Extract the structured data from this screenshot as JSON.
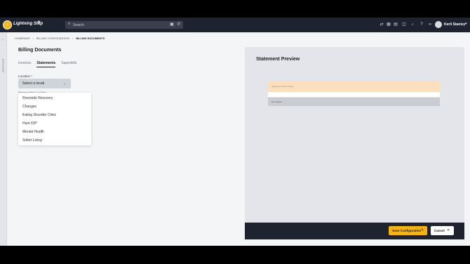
{
  "app": {
    "brand": "Lightning Step"
  },
  "search": {
    "placeholder": "Search"
  },
  "user": {
    "name": "Kerli Stanley"
  },
  "sidebar": {
    "collapsed_label": "Dashboard"
  },
  "breadcrumb": [
    "HOMEPAGE",
    "BILLING CONFIGURATION",
    "BILLING DOCUMENTS"
  ],
  "page": {
    "title": "Billing Documents"
  },
  "tabs": [
    {
      "label": "Invoices",
      "active": false
    },
    {
      "label": "Statements",
      "active": true
    },
    {
      "label": "Superbills",
      "active": false
    }
  ],
  "location": {
    "label": "Location *",
    "value": "Select a locati",
    "hint": "Please select Location",
    "options": [
      "Riverside Recovery",
      "Changes",
      "Eating Disorder Clinic",
      "Hunt IOP",
      "Mental Health",
      "Sober Living"
    ]
  },
  "preview": {
    "title": "Statement Preview",
    "header_text": "Statement data preview",
    "row_text": "No location"
  },
  "footer": {
    "save_label": "Save Configuration",
    "cancel_label": "Cancel"
  },
  "colors": {
    "accent": "#f2b21b",
    "topbar": "#1e2330"
  }
}
